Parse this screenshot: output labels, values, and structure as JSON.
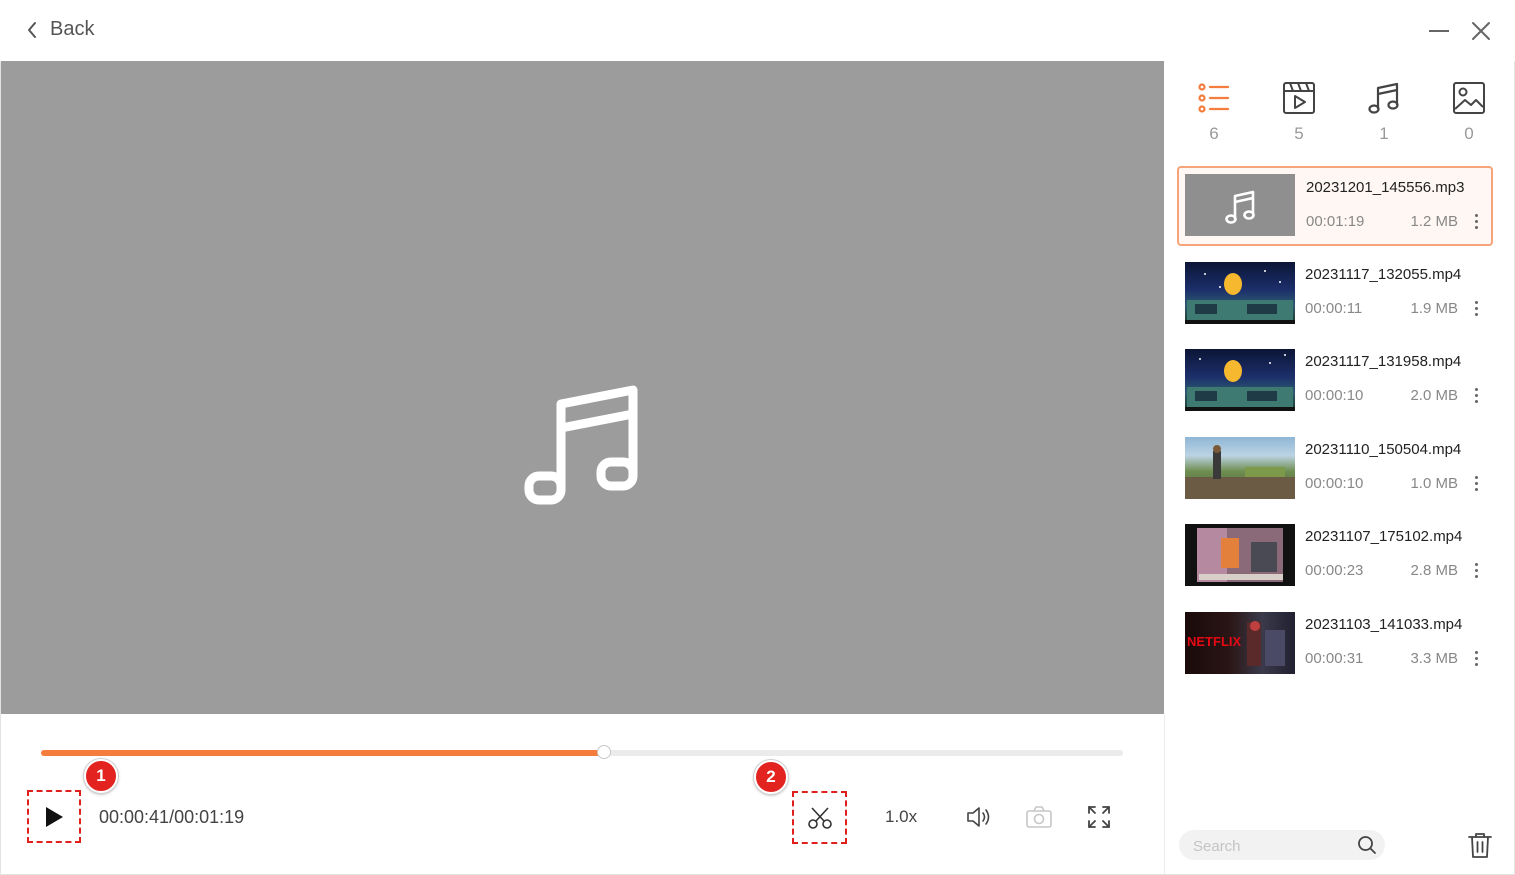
{
  "header": {
    "back_label": "Back"
  },
  "player": {
    "current_time": "00:00:41/00:01:19",
    "progress_fraction": 0.52,
    "speed_label": "1.0x",
    "annotations": [
      "1",
      "2"
    ]
  },
  "categories": [
    {
      "name": "all",
      "count": "6"
    },
    {
      "name": "video",
      "count": "5"
    },
    {
      "name": "audio",
      "count": "1"
    },
    {
      "name": "image",
      "count": "0"
    }
  ],
  "files": [
    {
      "name": "20231201_145556.mp3",
      "duration": "00:01:19",
      "size": "1.2 MB"
    },
    {
      "name": "20231117_132055.mp4",
      "duration": "00:00:11",
      "size": "1.9 MB"
    },
    {
      "name": "20231117_131958.mp4",
      "duration": "00:00:10",
      "size": "2.0 MB"
    },
    {
      "name": "20231110_150504.mp4",
      "duration": "00:00:10",
      "size": "1.0 MB"
    },
    {
      "name": "20231107_175102.mp4",
      "duration": "00:00:23",
      "size": "2.8 MB"
    },
    {
      "name": "20231103_141033.mp4",
      "duration": "00:00:31",
      "size": "3.3 MB"
    }
  ],
  "thumb_texts": {
    "netflix": "NETFLIX"
  },
  "search": {
    "placeholder": "Search",
    "value": ""
  },
  "colors": {
    "accent": "#f47c3c",
    "annotation_red": "#e3231f",
    "player_bg": "#9c9c9c"
  }
}
